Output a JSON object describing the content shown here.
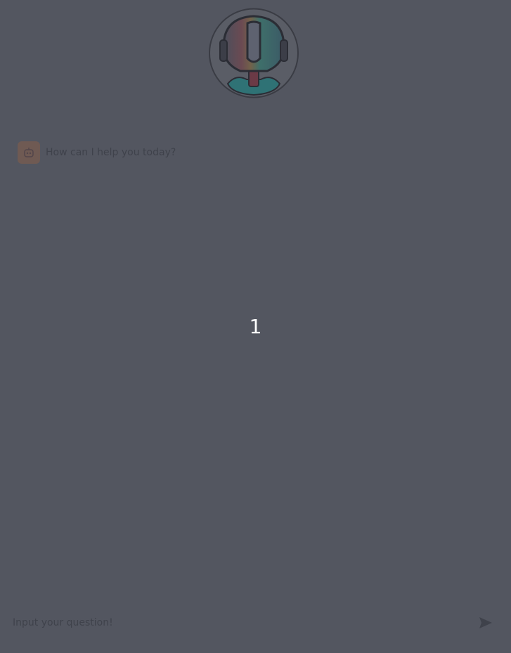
{
  "chat": {
    "assistant_avatar_icon": "robot-icon",
    "first_message": "How can I help you today?"
  },
  "countdown": {
    "value": "1"
  },
  "input": {
    "placeholder": "Input your question!",
    "value": "",
    "send_icon": "paper-plane-icon"
  },
  "colors": {
    "background": "#535660",
    "text_dim": "#3f424b",
    "avatar_bg": "#6f5a53",
    "countdown_text": "#ffffff"
  }
}
